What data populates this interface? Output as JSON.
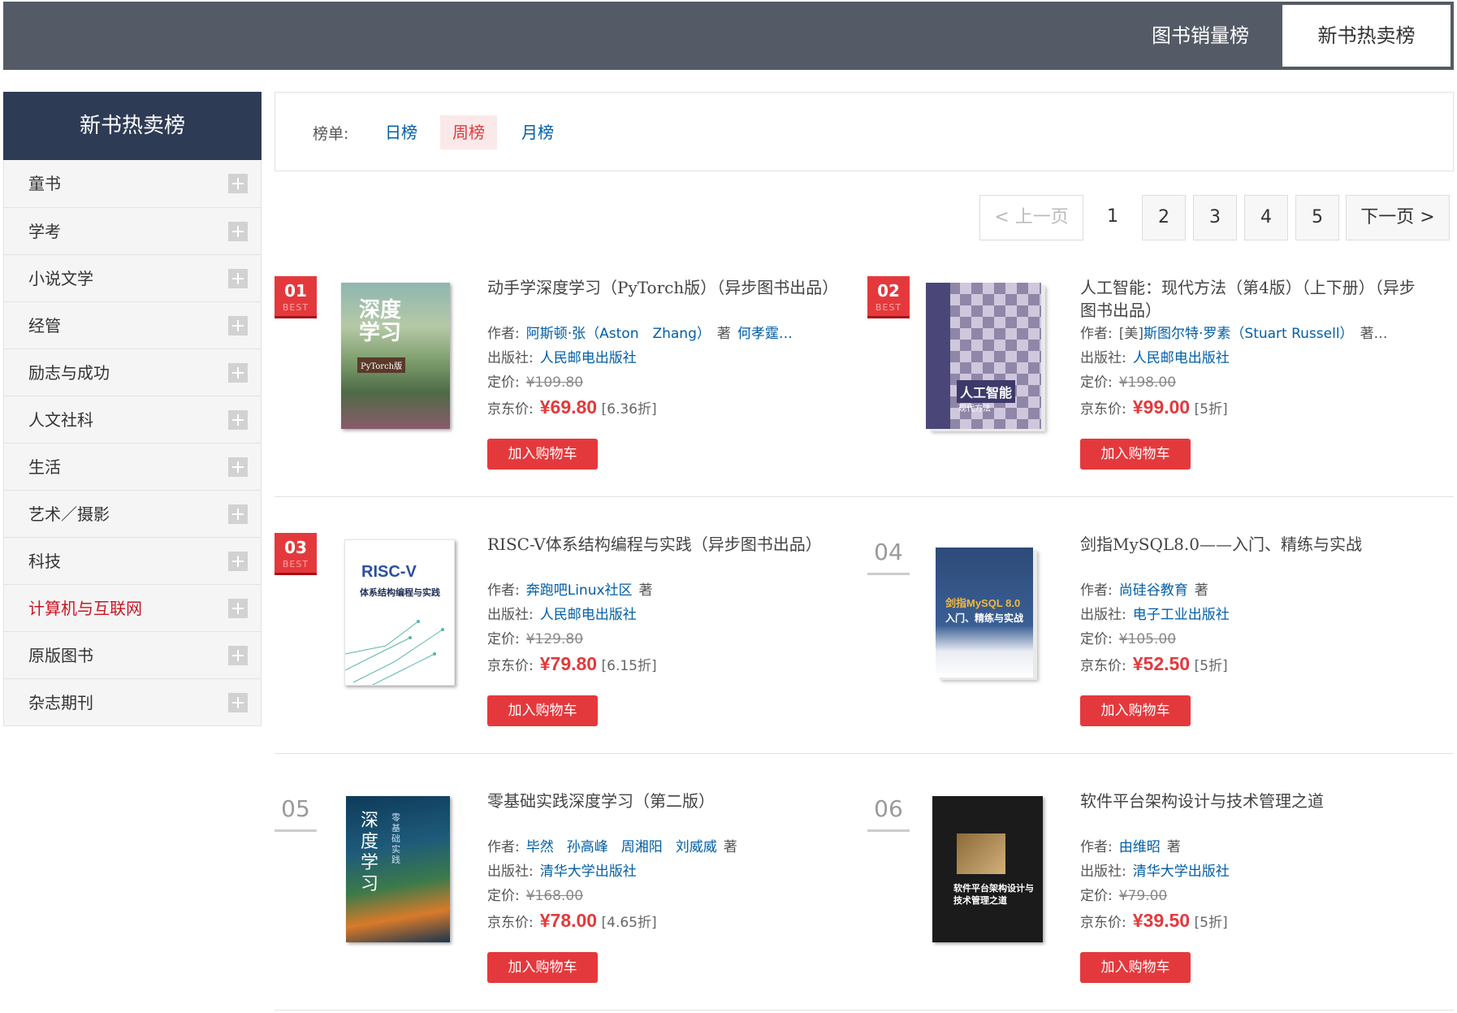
{
  "topbar": {
    "tab_sales": "图书销量榜",
    "tab_hot": "新书热卖榜"
  },
  "sidebar": {
    "title": "新书热卖榜",
    "items": [
      {
        "label": "童书"
      },
      {
        "label": "学考"
      },
      {
        "label": "小说文学"
      },
      {
        "label": "经管"
      },
      {
        "label": "励志与成功"
      },
      {
        "label": "人文社科"
      },
      {
        "label": "生活"
      },
      {
        "label": "艺术／摄影"
      },
      {
        "label": "科技"
      },
      {
        "label": "计算机与互联网",
        "active": true
      },
      {
        "label": "原版图书"
      },
      {
        "label": "杂志期刊"
      }
    ]
  },
  "filter": {
    "label": "榜单:",
    "day": "日榜",
    "week": "周榜",
    "month": "月榜",
    "selected": "周榜"
  },
  "pagination": {
    "prev": "< 上一页",
    "pages": [
      "1",
      "2",
      "3",
      "4",
      "5"
    ],
    "current": "1",
    "next": "下一页 >"
  },
  "labels": {
    "author": "作者:",
    "publisher": "出版社:",
    "list_price": "定价:",
    "jd_price": "京东价:",
    "add_to_cart": "加入购物车",
    "best": "BEST",
    "zhu": "著"
  },
  "accent_colors": {
    "brand_red": "#e4393c",
    "link_blue": "#005ea7",
    "header_gray": "#545b66",
    "sidebar_head": "#2e3b55"
  },
  "books": [
    {
      "rank": "01",
      "title": "动手学深度学习（PyTorch版）（异步图书出品）",
      "authors": [
        "阿斯顿·张（Aston　Zhang）"
      ],
      "authors_after": "何孝霆…",
      "publisher": "人民邮电出版社",
      "list_price": "¥109.80",
      "price": "¥69.80",
      "discount": "[6.36折]",
      "cover": {
        "title": "深度学习",
        "sub": "PyTorch版"
      }
    },
    {
      "rank": "02",
      "title": "人工智能：现代方法（第4版）（上下册）（异步图书出品）",
      "author_prefix": "[美]",
      "authors": [
        "斯图尔特·罗素（Stuart Russell）"
      ],
      "authors_suffix": "著…",
      "publisher": "人民邮电出版社",
      "list_price": "¥198.00",
      "price": "¥99.00",
      "discount": "[5折]",
      "cover": {
        "title": "人工智能",
        "sub": "现代方法"
      }
    },
    {
      "rank": "03",
      "title": "RISC-V体系结构编程与实践（异步图书出品）",
      "authors": [
        "奔跑吧Linux社区"
      ],
      "publisher": "人民邮电出版社",
      "list_price": "¥129.80",
      "price": "¥79.80",
      "discount": "[6.15折]",
      "cover": {
        "title": "RISC-V",
        "sub": "体系结构编程与实践"
      }
    },
    {
      "rank": "04",
      "title": "剑指MySQL8.0——入门、精练与实战",
      "authors": [
        "尚硅谷教育"
      ],
      "publisher": "电子工业出版社",
      "list_price": "¥105.00",
      "price": "¥52.50",
      "discount": "[5折]",
      "cover": {
        "title": "剑指MySQL 8.0",
        "sub": "入门、精练与实战"
      }
    },
    {
      "rank": "05",
      "title": "零基础实践深度学习（第二版）",
      "authors": [
        "毕然",
        "孙高峰",
        "周湘阳",
        "刘威威"
      ],
      "publisher": "清华大学出版社",
      "list_price": "¥168.00",
      "price": "¥78.00",
      "discount": "[4.65折]",
      "cover": {
        "title": "深度学习",
        "sub": "零基础实践"
      }
    },
    {
      "rank": "06",
      "title": "软件平台架构设计与技术管理之道",
      "authors": [
        "由维昭"
      ],
      "publisher": "清华大学出版社",
      "list_price": "¥79.00",
      "price": "¥39.50",
      "discount": "[5折]",
      "cover": {
        "title": "软件平台架构设计与技术管理之道",
        "sub": ""
      }
    }
  ]
}
